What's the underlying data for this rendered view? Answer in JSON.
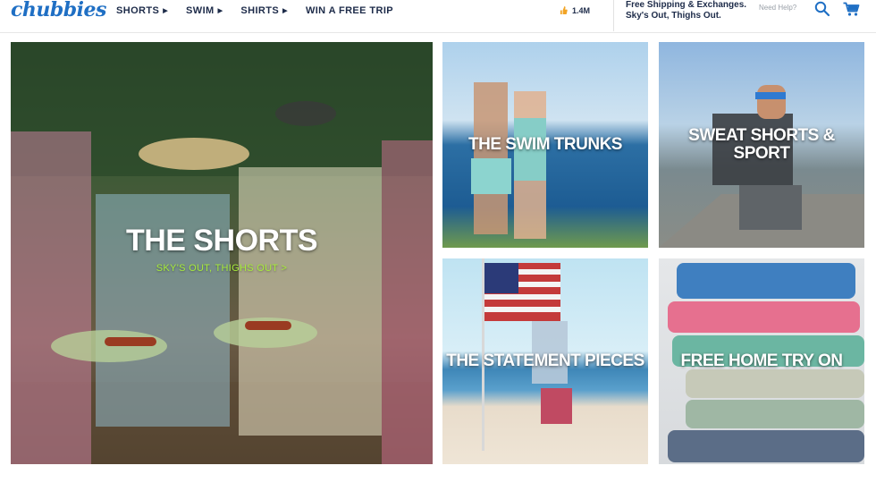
{
  "brand": {
    "logo": "chubbies",
    "color": "#1f6fc4"
  },
  "nav": [
    {
      "label": "SHORTS",
      "has_menu": true
    },
    {
      "label": "SWIM",
      "has_menu": true
    },
    {
      "label": "SHIRTS",
      "has_menu": true
    },
    {
      "label": "WIN A FREE TRIP",
      "has_menu": false
    }
  ],
  "social": {
    "icon": "thumbs-up-icon",
    "count": "1.4M"
  },
  "promo": {
    "line1": "Free Shipping & Exchanges.",
    "line2": "Sky's Out, Thighs Out."
  },
  "help": {
    "label": "Need Help?"
  },
  "icons": {
    "search": "search-icon",
    "cart": "cart-icon"
  },
  "tiles": {
    "shorts": {
      "title": "THE SHORTS",
      "subtitle": "SKY'S OUT, THIGHS OUT >"
    },
    "swim": {
      "title": "THE SWIM TRUNKS"
    },
    "sweat": {
      "title": "SWEAT SHORTS & SPORT"
    },
    "statement": {
      "title": "THE STATEMENT PIECES"
    },
    "tryon": {
      "title": "FREE HOME TRY ON"
    }
  },
  "colors": {
    "nav_text": "#1d2b49",
    "accent_green": "#a8ec3c"
  }
}
